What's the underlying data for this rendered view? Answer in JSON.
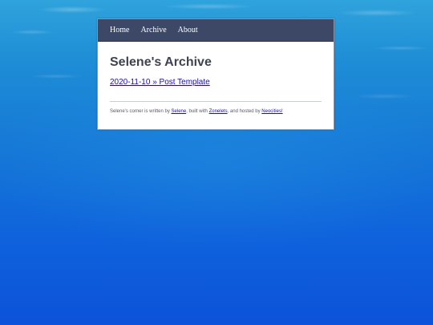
{
  "nav": {
    "items": [
      {
        "label": "Home"
      },
      {
        "label": "Archive"
      },
      {
        "label": "About"
      }
    ]
  },
  "page": {
    "title": "Selene's Archive",
    "post_link": "2020-11-10 » Post Template"
  },
  "footer": {
    "text_before_author": "Selene's corner is written by ",
    "author_link": "Selene",
    "text_before_builder": ", built with ",
    "builder_link": "Zonelets",
    "text_before_host": ", and hosted by ",
    "host_link": "Neocities!"
  },
  "colors": {
    "navbar": "#3c4866",
    "background_top": "#2fa3dc",
    "background_bottom": "#0c52da",
    "link": "#1a0dab"
  }
}
